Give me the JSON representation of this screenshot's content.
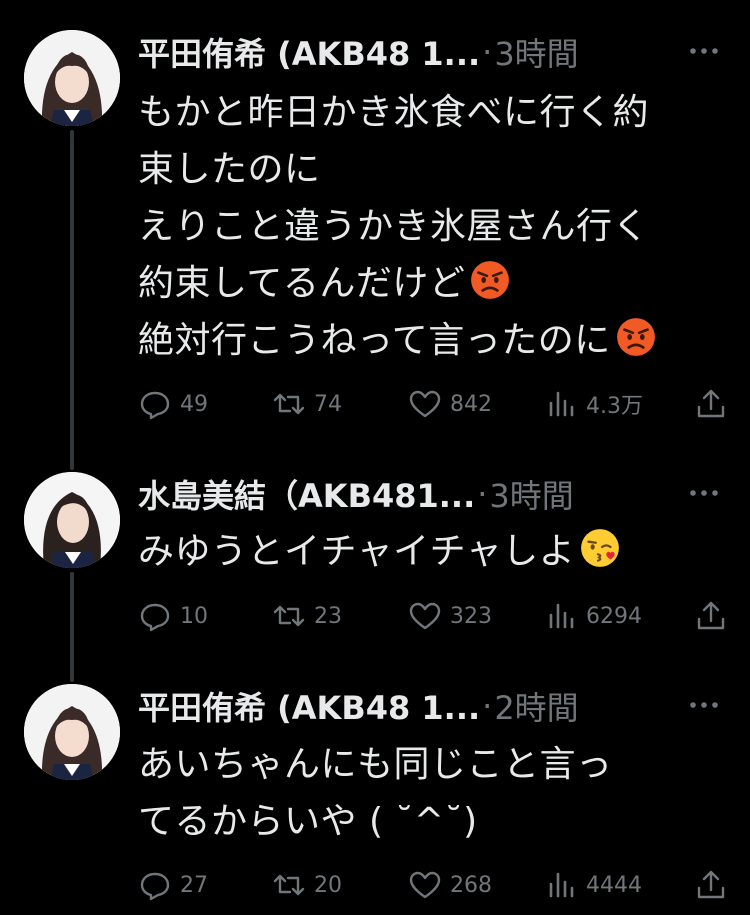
{
  "tweets": [
    {
      "name": "平田侑希 (AKB48 1...",
      "time": "3時間",
      "lines": [
        "もかと昨日かき氷食べに行く約",
        "束したのに",
        "えりこと違うかき氷屋さん行く",
        "約束してるんだけど",
        "絶対行こうねって言ったのに"
      ],
      "line_emojis": [
        "",
        "",
        "",
        "pouting-face",
        "pouting-face"
      ],
      "stats": {
        "replies": "49",
        "retweets": "74",
        "likes": "842",
        "views": "4.3万"
      }
    },
    {
      "name": "水島美結（AKB481...",
      "time": "3時間",
      "lines": [
        "みゆうとイチャイチャしよ"
      ],
      "line_emojis": [
        "kissing-heart-face"
      ],
      "stats": {
        "replies": "10",
        "retweets": "23",
        "likes": "323",
        "views": "6294"
      }
    },
    {
      "name": "平田侑希 (AKB48 1...",
      "time": "2時間",
      "lines": [
        "あいちゃんにも同じこと言っ",
        "てるからいや ( ˘^˘)"
      ],
      "line_emojis": [
        "",
        ""
      ],
      "stats": {
        "replies": "27",
        "retweets": "20",
        "likes": "268",
        "views": "4444"
      }
    }
  ],
  "colors": {
    "background": "#000000",
    "text": "#e7e9ea",
    "secondary": "#71767b",
    "thread_line": "#333639"
  }
}
